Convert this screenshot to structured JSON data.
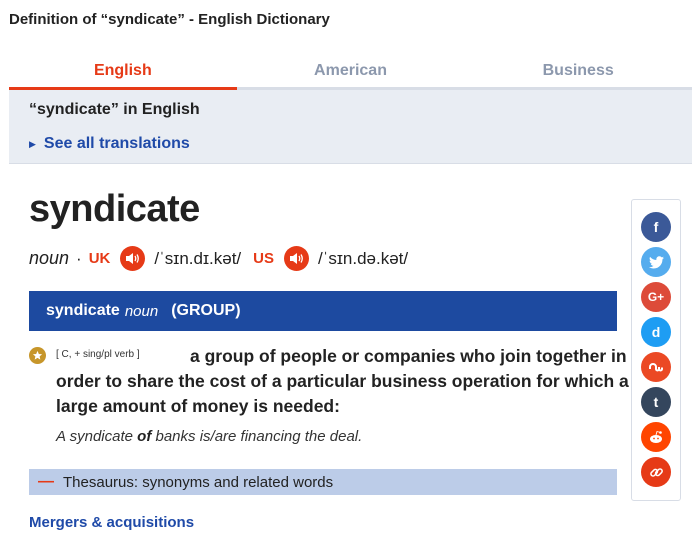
{
  "page_heading": "Definition of “syndicate” - English Dictionary",
  "tabs": [
    {
      "label": "English",
      "active": true
    },
    {
      "label": "American",
      "active": false
    },
    {
      "label": "Business",
      "active": false
    }
  ],
  "translations": {
    "title": "“syndicate” in English",
    "see_all": "See all translations"
  },
  "entry": {
    "headword": "syndicate",
    "pos": "noun",
    "separator": "·",
    "uk_label": "UK",
    "uk_ipa": "/ˈsɪn.dɪ.kət/",
    "us_label": "US",
    "us_ipa": "/ˈsɪn.də.kət/"
  },
  "sense": {
    "word": "syndicate",
    "pos": "noun",
    "guideword": "(GROUP)"
  },
  "definition": {
    "grammar": "[ C, + sing/pl verb ]",
    "text": "a group of people or companies who join together in order to share the cost of a particular business operation for which a large amount of money is needed:",
    "example_before": "A syndicate ",
    "example_bold": "of",
    "example_after": " banks is/are financing the deal."
  },
  "thesaurus": {
    "label": "Thesaurus: synonyms and related words"
  },
  "related_topic": "Mergers & acquisitions",
  "share_buttons": [
    {
      "name": "facebook",
      "glyph": "f",
      "color": "#3b5998"
    },
    {
      "name": "twitter",
      "glyph": "",
      "color": "#55acee"
    },
    {
      "name": "google-plus",
      "glyph": "G+",
      "color": "#dd4b39"
    },
    {
      "name": "delicious",
      "glyph": "d",
      "color": "#1e9df3"
    },
    {
      "name": "stumbleupon",
      "glyph": "",
      "color": "#eb4924"
    },
    {
      "name": "tumblr",
      "glyph": "t",
      "color": "#34465d"
    },
    {
      "name": "reddit",
      "glyph": "",
      "color": "#ff4500"
    },
    {
      "name": "copy-link",
      "glyph": "",
      "color": "#e63a17"
    }
  ],
  "colors": {
    "accent": "#e63a17",
    "link": "#1f4aa8",
    "sense_bar": "#1d4aa0",
    "thesaurus_bg": "#bccce8"
  }
}
